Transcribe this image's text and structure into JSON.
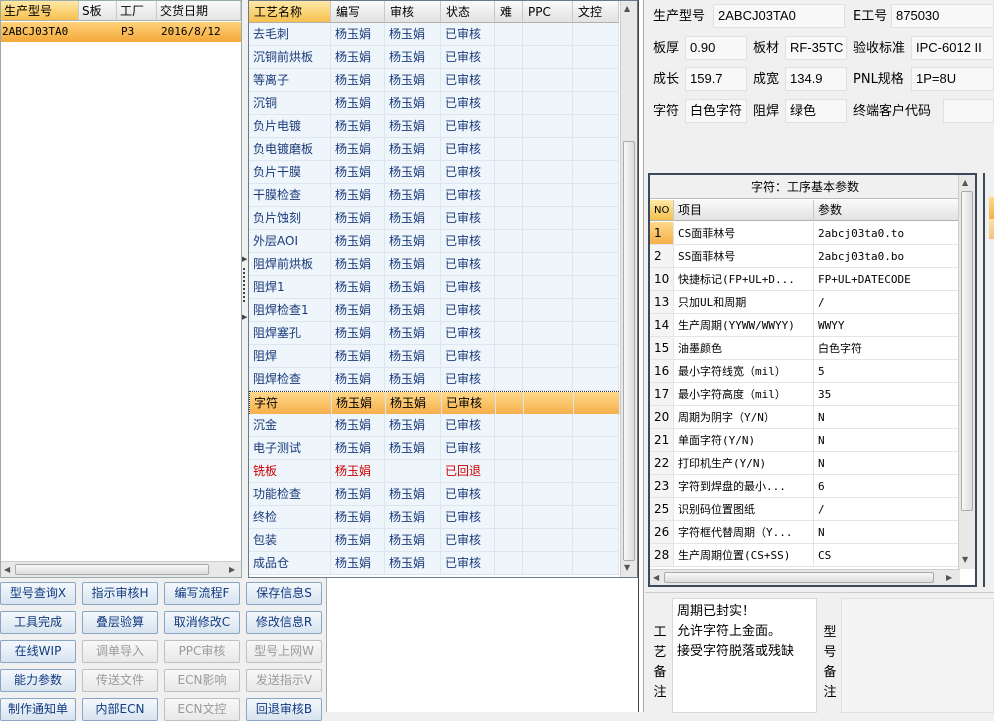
{
  "left_grid": {
    "headers": [
      "生产型号",
      "S板",
      "工厂",
      "交货日期"
    ],
    "rows": [
      {
        "model": "2ABCJ03TA0",
        "s": "",
        "factory": "P3",
        "date": "2016/8/12"
      }
    ]
  },
  "process_grid": {
    "headers": [
      "工艺名称",
      "编写",
      "审核",
      "状态",
      "难",
      "PPC",
      "文控"
    ],
    "rows": [
      {
        "name": "去毛刺",
        "author": "杨玉娟",
        "reviewer": "杨玉娟",
        "status": "已审核"
      },
      {
        "name": "沉铜前烘板",
        "author": "杨玉娟",
        "reviewer": "杨玉娟",
        "status": "已审核"
      },
      {
        "name": "等离子",
        "author": "杨玉娟",
        "reviewer": "杨玉娟",
        "status": "已审核"
      },
      {
        "name": "沉铜",
        "author": "杨玉娟",
        "reviewer": "杨玉娟",
        "status": "已审核"
      },
      {
        "name": "负片电镀",
        "author": "杨玉娟",
        "reviewer": "杨玉娟",
        "status": "已审核"
      },
      {
        "name": "负电镀磨板",
        "author": "杨玉娟",
        "reviewer": "杨玉娟",
        "status": "已审核"
      },
      {
        "name": "负片干膜",
        "author": "杨玉娟",
        "reviewer": "杨玉娟",
        "status": "已审核"
      },
      {
        "name": "干膜检查",
        "author": "杨玉娟",
        "reviewer": "杨玉娟",
        "status": "已审核"
      },
      {
        "name": "负片蚀刻",
        "author": "杨玉娟",
        "reviewer": "杨玉娟",
        "status": "已审核"
      },
      {
        "name": "外层AOI",
        "author": "杨玉娟",
        "reviewer": "杨玉娟",
        "status": "已审核"
      },
      {
        "name": "阻焊前烘板",
        "author": "杨玉娟",
        "reviewer": "杨玉娟",
        "status": "已审核"
      },
      {
        "name": "阻焊1",
        "author": "杨玉娟",
        "reviewer": "杨玉娟",
        "status": "已审核"
      },
      {
        "name": "阻焊检查1",
        "author": "杨玉娟",
        "reviewer": "杨玉娟",
        "status": "已审核"
      },
      {
        "name": "阻焊塞孔",
        "author": "杨玉娟",
        "reviewer": "杨玉娟",
        "status": "已审核"
      },
      {
        "name": "阻焊",
        "author": "杨玉娟",
        "reviewer": "杨玉娟",
        "status": "已审核"
      },
      {
        "name": "阻焊检查",
        "author": "杨玉娟",
        "reviewer": "杨玉娟",
        "status": "已审核"
      },
      {
        "name": "字符",
        "author": "杨玉娟",
        "reviewer": "杨玉娟",
        "status": "已审核"
      },
      {
        "name": "沉金",
        "author": "杨玉娟",
        "reviewer": "杨玉娟",
        "status": "已审核"
      },
      {
        "name": "电子测试",
        "author": "杨玉娟",
        "reviewer": "杨玉娟",
        "status": "已审核"
      },
      {
        "name": "铣板",
        "author": "杨玉娟",
        "reviewer": "",
        "status": "已回退"
      },
      {
        "name": "功能检查",
        "author": "杨玉娟",
        "reviewer": "杨玉娟",
        "status": "已审核"
      },
      {
        "name": "终检",
        "author": "杨玉娟",
        "reviewer": "杨玉娟",
        "status": "已审核"
      },
      {
        "name": "包装",
        "author": "杨玉娟",
        "reviewer": "杨玉娟",
        "status": "已审核"
      },
      {
        "name": "成品仓",
        "author": "杨玉娟",
        "reviewer": "杨玉娟",
        "status": "已审核"
      }
    ]
  },
  "buttons": {
    "row1": [
      "型号查询X",
      "指示审核H",
      "编写流程F",
      "保存信息S"
    ],
    "row2": [
      "工具完成",
      "叠层验算",
      "取消修改C",
      "修改信息R"
    ],
    "row3": [
      "在线WIP",
      "调单导入",
      "PPC审核",
      "型号上网W"
    ],
    "row4": [
      "能力参数",
      "传送文件",
      "ECN影响",
      "发送指示V"
    ],
    "row5": [
      "制作通知单",
      "内部ECN",
      "ECN文控",
      "回退审核B"
    ]
  },
  "info": {
    "model_label": "生产型号",
    "model_value": "2ABCJ03TA0",
    "e_label": "E工号",
    "e_value": "875030",
    "thickness_label": "板厚",
    "thickness_value": "0.90",
    "material_label": "板材",
    "material_value": "RF-35TC",
    "standard_label": "验收标准",
    "standard_value": "IPC-6012 II",
    "length_label": "成长",
    "length_value": "159.7",
    "width_label": "成宽",
    "width_value": "134.9",
    "pnl_label": "PNL规格",
    "pnl_value": "1P=8U",
    "char_label": "字符",
    "char_value": "白色字符",
    "mask_label": "阻焊",
    "mask_value": "绿色",
    "customer_code_label": "终端客户代码",
    "customer_code_value": ""
  },
  "params": {
    "title": "字符：工序基本参数",
    "headers": [
      "NO",
      "项目",
      "参数"
    ],
    "rows": [
      {
        "no": "1",
        "item": "CS面菲林号",
        "value": "2abcj03ta0.to"
      },
      {
        "no": "2",
        "item": "SS面菲林号",
        "value": "2abcj03ta0.bo"
      },
      {
        "no": "10",
        "item": "快捷标记(FP+UL+D...",
        "value": "FP+UL+DATECODE"
      },
      {
        "no": "13",
        "item": "只加UL和周期",
        "value": "/"
      },
      {
        "no": "14",
        "item": "生产周期(YYWW/WWYY)",
        "value": "WWYY"
      },
      {
        "no": "15",
        "item": "油墨颜色",
        "value": "白色字符"
      },
      {
        "no": "16",
        "item": "最小字符线宽（mil）",
        "value": "5"
      },
      {
        "no": "17",
        "item": "最小字符高度（mil）",
        "value": "35"
      },
      {
        "no": "20",
        "item": "周期为阴字（Y/N）",
        "value": "N"
      },
      {
        "no": "21",
        "item": "单面字符(Y/N)",
        "value": "N"
      },
      {
        "no": "22",
        "item": "打印机生产(Y/N)",
        "value": "N"
      },
      {
        "no": "23",
        "item": "字符到焊盘的最小...",
        "value": "6"
      },
      {
        "no": "25",
        "item": "识别码位置图纸",
        "value": "/"
      },
      {
        "no": "26",
        "item": "字符框代替周期（Y...",
        "value": "N"
      },
      {
        "no": "28",
        "item": "生产周期位置(CS+SS)",
        "value": "CS"
      }
    ]
  },
  "remarks": {
    "process_label": [
      "工",
      "艺",
      "备",
      "注"
    ],
    "process_text": "周期已封实！\n允许字符上金面。\n接受字符脱落或残缺",
    "model_label": [
      "型",
      "号",
      "备",
      "注"
    ]
  }
}
